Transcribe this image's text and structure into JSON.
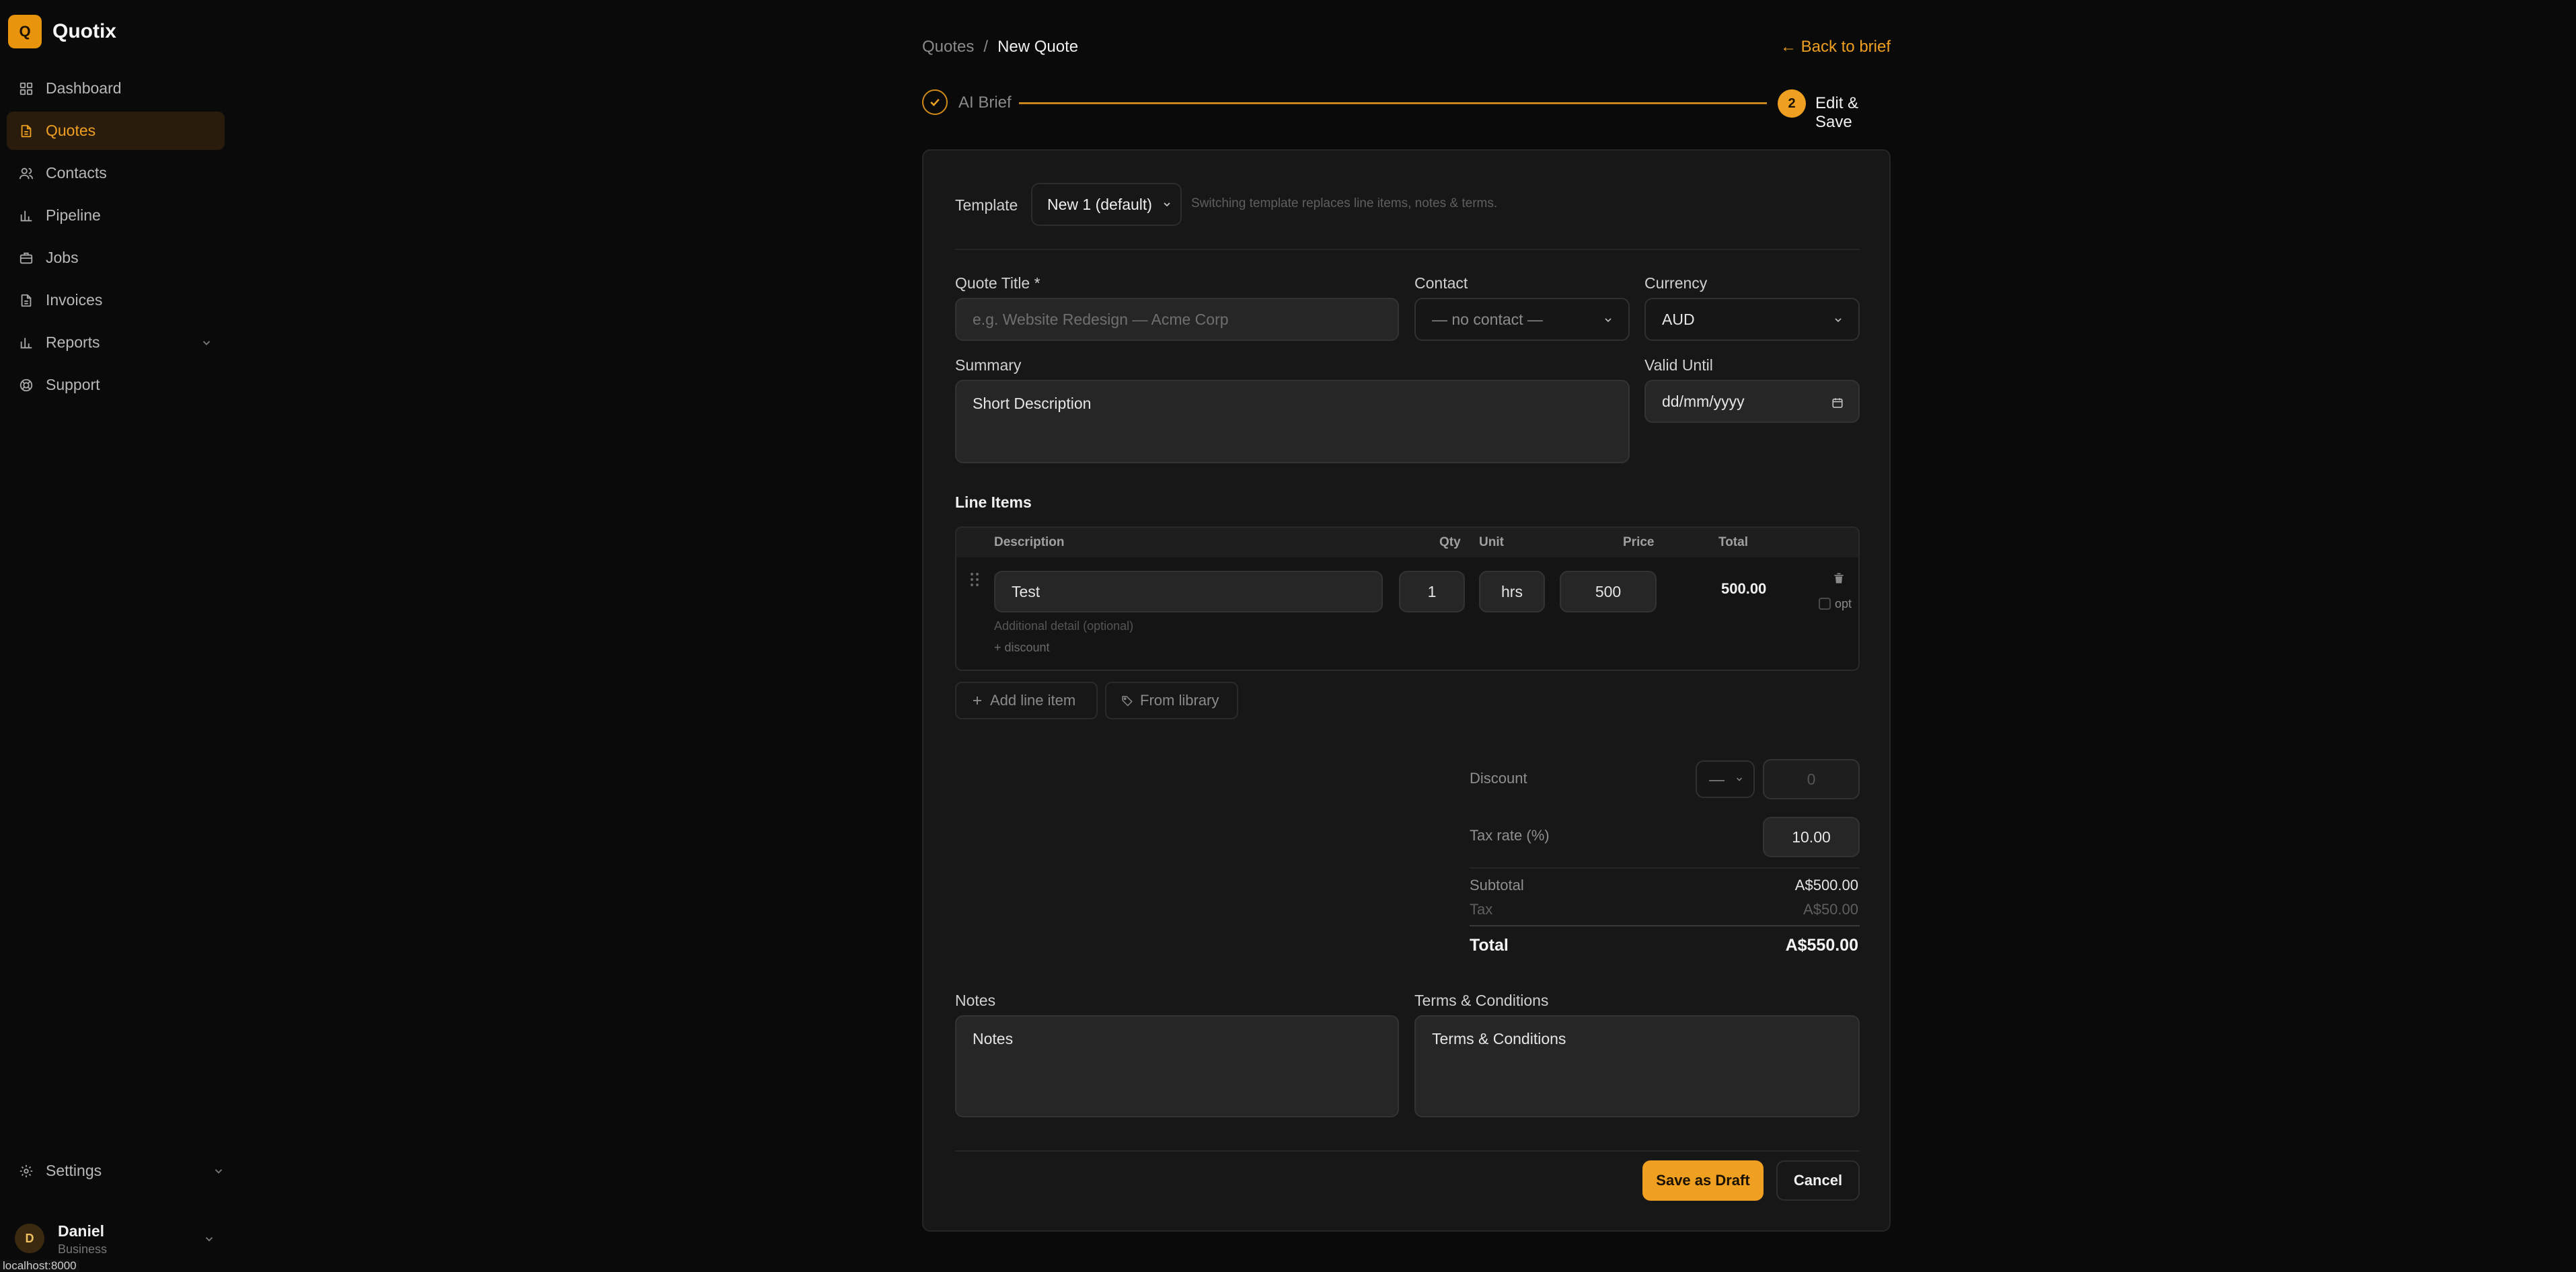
{
  "app": {
    "logo_letter": "Q",
    "name": "Quotix"
  },
  "sidebar": {
    "items": [
      {
        "label": "Dashboard",
        "icon": "grid-icon"
      },
      {
        "label": "Quotes",
        "icon": "file-icon",
        "active": true
      },
      {
        "label": "Contacts",
        "icon": "users-icon"
      },
      {
        "label": "Pipeline",
        "icon": "bar-chart-icon"
      },
      {
        "label": "Jobs",
        "icon": "briefcase-icon"
      },
      {
        "label": "Invoices",
        "icon": "file-icon"
      },
      {
        "label": "Reports",
        "icon": "bar-chart-icon",
        "expandable": true
      },
      {
        "label": "Support",
        "icon": "lifebuoy-icon"
      }
    ],
    "settings": "Settings",
    "user": {
      "initial": "D",
      "name": "Daniel",
      "plan": "Business"
    }
  },
  "statusbar": "localhost:8000",
  "header": {
    "breadcrumb_root": "Quotes",
    "breadcrumb_sep": "/",
    "breadcrumb_current": "New Quote",
    "back_link": "← Back to brief"
  },
  "stepper": {
    "step1": "AI Brief",
    "step2_number": "2",
    "step2": "Edit & Save"
  },
  "form": {
    "template_label": "Template",
    "template_value": "New 1 (default)",
    "template_hint": "Switching template replaces line items, notes & terms.",
    "title_label": "Quote Title *",
    "title_placeholder": "e.g. Website Redesign — Acme Corp",
    "contact_label": "Contact",
    "contact_value": "— no contact —",
    "currency_label": "Currency",
    "currency_value": "AUD",
    "summary_label": "Summary",
    "summary_value": "Short Description",
    "valid_label": "Valid Until",
    "valid_value": "dd/mm/yyyy"
  },
  "line_items": {
    "heading": "Line Items",
    "columns": [
      "Description",
      "Qty",
      "Unit",
      "Price",
      "Total"
    ],
    "rows": [
      {
        "description": "Test",
        "qty": "1",
        "unit": "hrs",
        "price": "500",
        "total": "500.00",
        "detail_placeholder": "Additional detail (optional)",
        "discount_link": "+ discount",
        "optional_label": "opt"
      }
    ],
    "add_button": "Add line item",
    "library_button": "From library"
  },
  "totals": {
    "discount_label": "Discount",
    "discount_type": "—",
    "discount_value": "0",
    "tax_label": "Tax rate (%)",
    "tax_value": "10.00",
    "subtotal_label": "Subtotal",
    "subtotal_value": "A$500.00",
    "tax_row_label": "Tax",
    "tax_row_value": "A$50.00",
    "total_label": "Total",
    "total_value": "A$550.00"
  },
  "notes": {
    "label": "Notes",
    "value": "Notes"
  },
  "terms": {
    "label": "Terms & Conditions",
    "value": "Terms & Conditions"
  },
  "actions": {
    "save": "Save as Draft",
    "cancel": "Cancel"
  },
  "colors": {
    "accent": "#f0a020",
    "background": "#0a0a0a",
    "card": "#171717",
    "field": "#262626"
  }
}
